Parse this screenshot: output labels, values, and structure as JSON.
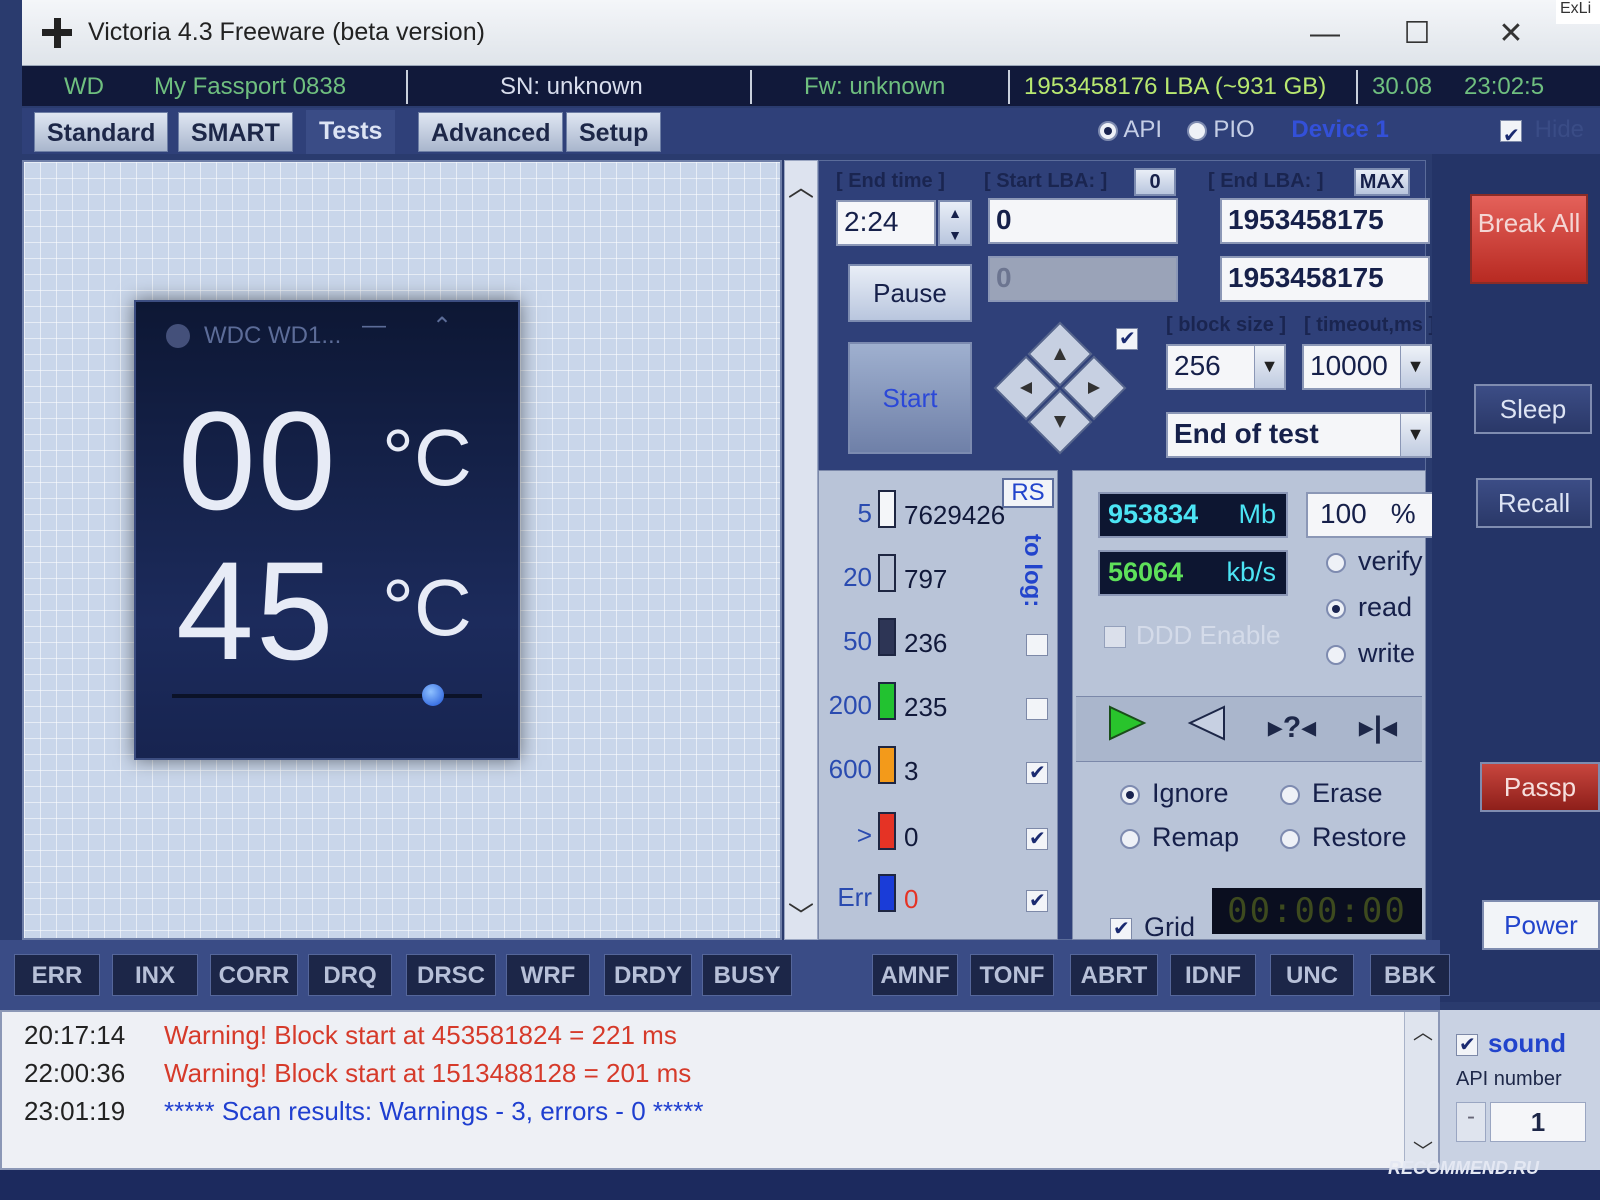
{
  "window": {
    "title": "Victoria 4.3 Freeware (beta version)",
    "corner_label": "ExLi"
  },
  "infobar": {
    "vendor": "WD",
    "model": "My Fassport 0838",
    "serial": "SN: unknown",
    "firmware": "Fw: unknown",
    "capacity": "1953458176 LBA (~931 GB)",
    "date": "30.08",
    "time": "23:02:5"
  },
  "tabs": [
    "Standard",
    "SMART",
    "Tests",
    "Advanced",
    "Setup"
  ],
  "active_tab": "Tests",
  "top_options": {
    "api_label": "API",
    "pio_label": "PIO",
    "device_label": "Device 1",
    "hide_label": "Hide"
  },
  "gadget": {
    "title": "WDC WD1...",
    "temp1": "00",
    "temp2": "45",
    "unit": "°C",
    "slider_position": 0.82
  },
  "test": {
    "end_time_label": "[ End time ]",
    "end_time_value": "2:24",
    "start_lba_label": "[ Start LBA: ]",
    "start_lba_reset": "0",
    "start_lba_value": "0",
    "start_lba_current": "0",
    "end_lba_label": "[ End LBA: ]",
    "end_lba_max": "MAX",
    "end_lba_value": "1953458175",
    "end_lba_current": "1953458175",
    "pause_label": "Pause",
    "start_label": "Start",
    "block_size_label": "[ block size ]",
    "block_size_value": "256",
    "timeout_label": "[ timeout,ms ]",
    "timeout_value": "10000",
    "end_action_value": "End of test"
  },
  "stats": {
    "rs_label": "RS",
    "to_log_label": "to log:",
    "rows": [
      {
        "threshold": "5",
        "count": "7629426",
        "color": "#f4f6f9"
      },
      {
        "threshold": "20",
        "count": "797",
        "color": "#b8c2d6"
      },
      {
        "threshold": "50",
        "count": "236",
        "color": "#2d3555"
      },
      {
        "threshold": "200",
        "count": "235",
        "color": "#22c230"
      },
      {
        "threshold": "600",
        "count": "3",
        "color": "#f39a1a"
      },
      {
        "threshold": ">",
        "count": "0",
        "color": "#e53325"
      },
      {
        "threshold": "Err",
        "count": "0",
        "color": "#1a3cd8"
      }
    ]
  },
  "progress": {
    "mb_value": "953834",
    "mb_unit": "Mb",
    "percent_value": "100",
    "percent_unit": "%",
    "speed_value": "56064",
    "speed_unit": "kb/s",
    "ddd_label": "DDD Enable",
    "mode_options": [
      "verify",
      "read",
      "write"
    ],
    "mode_selected": "read",
    "action_options": [
      "Ignore",
      "Erase",
      "Remap",
      "Restore"
    ],
    "action_selected": "Ignore",
    "grid_label": "Grid",
    "timer": "00:00:00"
  },
  "side": {
    "break_all": "Break All",
    "sleep": "Sleep",
    "recall": "Recall",
    "passp": "Passp",
    "power": "Power"
  },
  "flags": [
    "ERR",
    "INX",
    "CORR",
    "DRQ",
    "DRSC",
    "WRF",
    "DRDY",
    "BUSY",
    "AMNF",
    "TONF",
    "ABRT",
    "IDNF",
    "UNC",
    "BBK"
  ],
  "log": [
    {
      "time": "20:17:14",
      "text": "Warning! Block start at 453581824 = 221 ms",
      "color": "#d63a2a"
    },
    {
      "time": "22:00:36",
      "text": "Warning! Block start at 1513488128 = 201 ms",
      "color": "#d63a2a"
    },
    {
      "time": "23:01:19",
      "text": "***** Scan results: Warnings - 3, errors - 0 *****",
      "color": "#1f3fd0"
    }
  ],
  "sound_panel": {
    "sound_label": "sound",
    "api_number_label": "API number",
    "api_number_value": "1",
    "minus_label": "-"
  },
  "watermark": "RECOMMEND.RU"
}
